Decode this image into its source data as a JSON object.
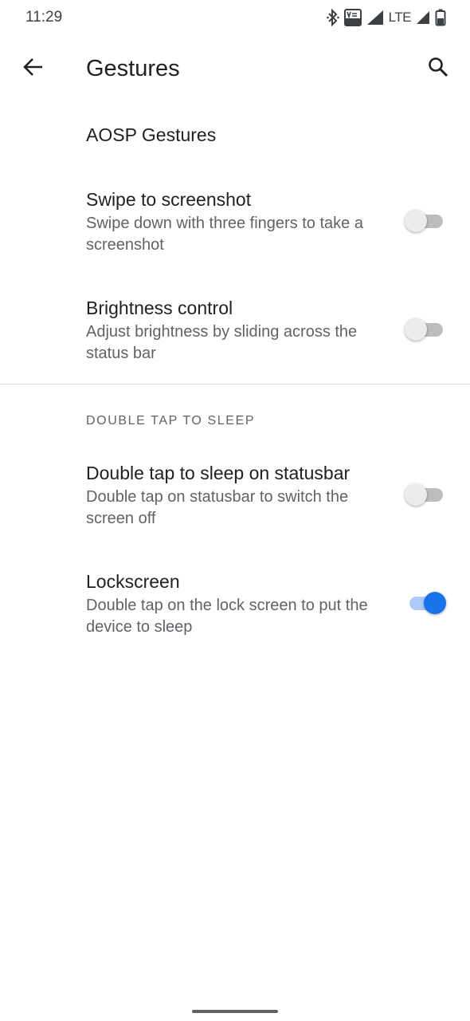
{
  "status_bar": {
    "time": "11:29",
    "network_label": "LTE",
    "icons": [
      "bluetooth-icon",
      "volte-icon",
      "signal-icon",
      "signal-icon",
      "battery-icon"
    ]
  },
  "app_bar": {
    "title": "Gestures",
    "back_icon": "arrow-back-icon",
    "search_icon": "search-icon"
  },
  "section": {
    "header": "AOSP Gestures"
  },
  "prefs_main": [
    {
      "title": "Swipe to screenshot",
      "summary": "Swipe down with three fingers to take a screenshot",
      "enabled": false
    },
    {
      "title": "Brightness control",
      "summary": "Adjust brightness by sliding across the status bar",
      "enabled": false
    }
  ],
  "double_tap": {
    "category": "DOUBLE TAP TO SLEEP",
    "items": [
      {
        "title": "Double tap to sleep on statusbar",
        "summary": "Double tap on statusbar to switch the screen off",
        "enabled": false
      },
      {
        "title": "Lockscreen",
        "summary": "Double tap on the lock screen to put the device to sleep",
        "enabled": true
      }
    ]
  },
  "colors": {
    "accent": "#1a73e8",
    "accent_track": "#aecbfa",
    "text_primary": "#202124",
    "text_secondary": "#5f6368"
  }
}
